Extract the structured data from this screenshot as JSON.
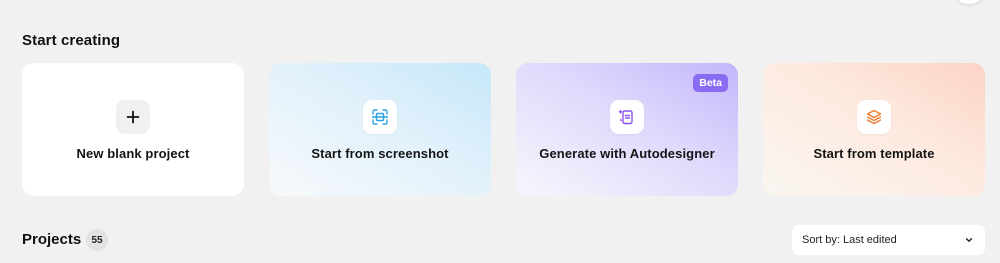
{
  "start_creating": {
    "title": "Start creating",
    "cards": [
      {
        "label": "New blank project",
        "icon": "plus-icon"
      },
      {
        "label": "Start from screenshot",
        "icon": "screenshot-scan-icon"
      },
      {
        "label": "Generate with Autodesigner",
        "icon": "autodesigner-icon",
        "badge": "Beta"
      },
      {
        "label": "Start from template",
        "icon": "layers-icon"
      }
    ]
  },
  "projects": {
    "title": "Projects",
    "count": "55",
    "sort": {
      "label": "Sort by: Last edited"
    }
  },
  "colors": {
    "page_background": "#f1f1f1",
    "screenshot_accent": "#2aa3e6",
    "autodesigner_accent": "#8a52f0",
    "template_accent": "#f07a2e",
    "beta_badge": "#8a6cf2"
  }
}
